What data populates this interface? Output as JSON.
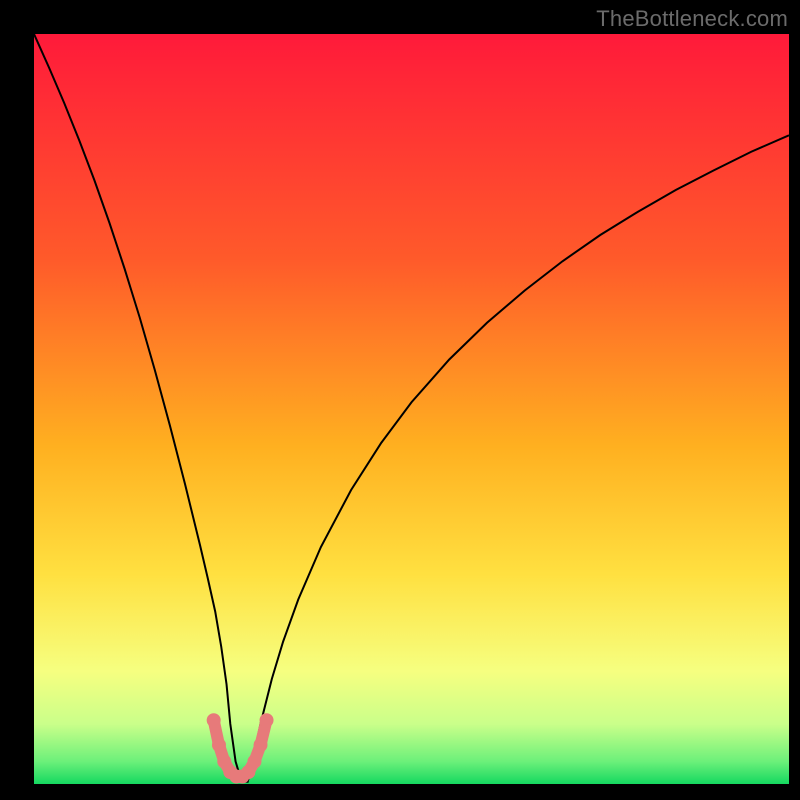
{
  "watermark": "TheBottleneck.com",
  "chart_data": {
    "type": "line",
    "title": "",
    "xlabel": "",
    "ylabel": "",
    "xlim": [
      0,
      100
    ],
    "ylim": [
      0,
      100
    ],
    "grid": false,
    "legend": false,
    "background_gradient": {
      "stops": [
        {
          "offset": 0.0,
          "color": "#ff1a3a"
        },
        {
          "offset": 0.3,
          "color": "#ff5a2a"
        },
        {
          "offset": 0.55,
          "color": "#ffb020"
        },
        {
          "offset": 0.72,
          "color": "#ffe040"
        },
        {
          "offset": 0.85,
          "color": "#f6ff80"
        },
        {
          "offset": 0.92,
          "color": "#caff8a"
        },
        {
          "offset": 0.97,
          "color": "#6cf07a"
        },
        {
          "offset": 1.0,
          "color": "#15d860"
        }
      ]
    },
    "series": [
      {
        "name": "bottleneck-curve",
        "color": "#000000",
        "width": 2,
        "x": [
          0,
          2,
          4,
          6,
          8,
          10,
          12,
          14,
          16,
          18,
          20,
          22,
          23,
          24,
          24.8,
          25.5,
          26,
          26.7,
          27.5,
          28.3,
          29,
          30,
          31.5,
          33,
          35,
          38,
          42,
          46,
          50,
          55,
          60,
          65,
          70,
          75,
          80,
          85,
          90,
          95,
          100
        ],
        "y": [
          100,
          95.5,
          90.8,
          85.8,
          80.5,
          74.8,
          68.7,
          62.2,
          55.2,
          47.8,
          40.0,
          31.8,
          27.5,
          23.0,
          18.3,
          13.3,
          8.0,
          3.0,
          0.3,
          0.3,
          3.2,
          8.0,
          14.0,
          19.0,
          24.6,
          31.6,
          39.2,
          45.5,
          50.9,
          56.6,
          61.5,
          65.8,
          69.7,
          73.2,
          76.3,
          79.2,
          81.8,
          84.3,
          86.5
        ]
      },
      {
        "name": "minimum-marker",
        "color": "#e77a7a",
        "width": 12,
        "linecap": "round",
        "x": [
          23.8,
          24.5,
          25.2,
          26.0,
          26.8,
          27.6,
          28.4,
          29.2,
          30.0,
          30.8
        ],
        "y": [
          8.5,
          5.2,
          3.0,
          1.6,
          1.0,
          1.0,
          1.6,
          3.0,
          5.2,
          8.5
        ]
      }
    ]
  }
}
